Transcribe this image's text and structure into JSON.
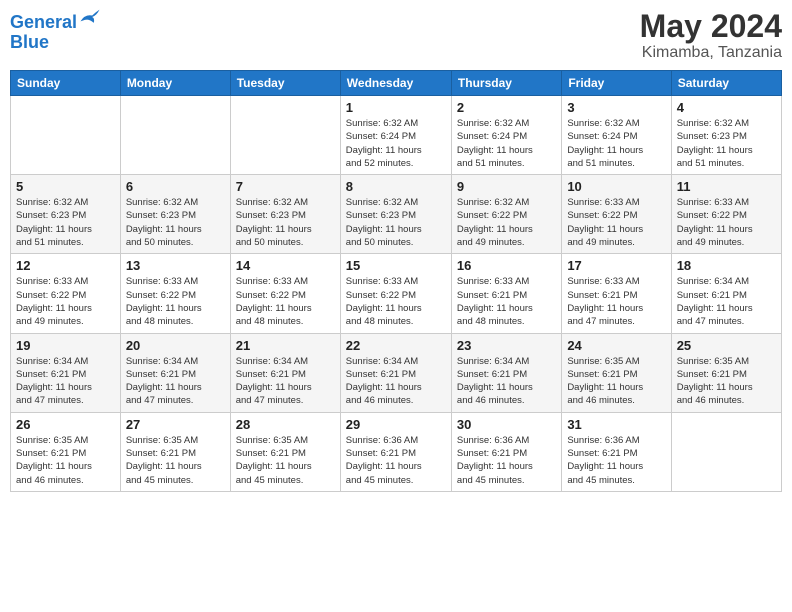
{
  "header": {
    "logo_line1": "General",
    "logo_line2": "Blue",
    "month": "May 2024",
    "location": "Kimamba, Tanzania"
  },
  "days_of_week": [
    "Sunday",
    "Monday",
    "Tuesday",
    "Wednesday",
    "Thursday",
    "Friday",
    "Saturday"
  ],
  "weeks": [
    [
      {
        "day": "",
        "info": ""
      },
      {
        "day": "",
        "info": ""
      },
      {
        "day": "",
        "info": ""
      },
      {
        "day": "1",
        "info": "Sunrise: 6:32 AM\nSunset: 6:24 PM\nDaylight: 11 hours\nand 52 minutes."
      },
      {
        "day": "2",
        "info": "Sunrise: 6:32 AM\nSunset: 6:24 PM\nDaylight: 11 hours\nand 51 minutes."
      },
      {
        "day": "3",
        "info": "Sunrise: 6:32 AM\nSunset: 6:24 PM\nDaylight: 11 hours\nand 51 minutes."
      },
      {
        "day": "4",
        "info": "Sunrise: 6:32 AM\nSunset: 6:23 PM\nDaylight: 11 hours\nand 51 minutes."
      }
    ],
    [
      {
        "day": "5",
        "info": "Sunrise: 6:32 AM\nSunset: 6:23 PM\nDaylight: 11 hours\nand 51 minutes."
      },
      {
        "day": "6",
        "info": "Sunrise: 6:32 AM\nSunset: 6:23 PM\nDaylight: 11 hours\nand 50 minutes."
      },
      {
        "day": "7",
        "info": "Sunrise: 6:32 AM\nSunset: 6:23 PM\nDaylight: 11 hours\nand 50 minutes."
      },
      {
        "day": "8",
        "info": "Sunrise: 6:32 AM\nSunset: 6:23 PM\nDaylight: 11 hours\nand 50 minutes."
      },
      {
        "day": "9",
        "info": "Sunrise: 6:32 AM\nSunset: 6:22 PM\nDaylight: 11 hours\nand 49 minutes."
      },
      {
        "day": "10",
        "info": "Sunrise: 6:33 AM\nSunset: 6:22 PM\nDaylight: 11 hours\nand 49 minutes."
      },
      {
        "day": "11",
        "info": "Sunrise: 6:33 AM\nSunset: 6:22 PM\nDaylight: 11 hours\nand 49 minutes."
      }
    ],
    [
      {
        "day": "12",
        "info": "Sunrise: 6:33 AM\nSunset: 6:22 PM\nDaylight: 11 hours\nand 49 minutes."
      },
      {
        "day": "13",
        "info": "Sunrise: 6:33 AM\nSunset: 6:22 PM\nDaylight: 11 hours\nand 48 minutes."
      },
      {
        "day": "14",
        "info": "Sunrise: 6:33 AM\nSunset: 6:22 PM\nDaylight: 11 hours\nand 48 minutes."
      },
      {
        "day": "15",
        "info": "Sunrise: 6:33 AM\nSunset: 6:22 PM\nDaylight: 11 hours\nand 48 minutes."
      },
      {
        "day": "16",
        "info": "Sunrise: 6:33 AM\nSunset: 6:21 PM\nDaylight: 11 hours\nand 48 minutes."
      },
      {
        "day": "17",
        "info": "Sunrise: 6:33 AM\nSunset: 6:21 PM\nDaylight: 11 hours\nand 47 minutes."
      },
      {
        "day": "18",
        "info": "Sunrise: 6:34 AM\nSunset: 6:21 PM\nDaylight: 11 hours\nand 47 minutes."
      }
    ],
    [
      {
        "day": "19",
        "info": "Sunrise: 6:34 AM\nSunset: 6:21 PM\nDaylight: 11 hours\nand 47 minutes."
      },
      {
        "day": "20",
        "info": "Sunrise: 6:34 AM\nSunset: 6:21 PM\nDaylight: 11 hours\nand 47 minutes."
      },
      {
        "day": "21",
        "info": "Sunrise: 6:34 AM\nSunset: 6:21 PM\nDaylight: 11 hours\nand 47 minutes."
      },
      {
        "day": "22",
        "info": "Sunrise: 6:34 AM\nSunset: 6:21 PM\nDaylight: 11 hours\nand 46 minutes."
      },
      {
        "day": "23",
        "info": "Sunrise: 6:34 AM\nSunset: 6:21 PM\nDaylight: 11 hours\nand 46 minutes."
      },
      {
        "day": "24",
        "info": "Sunrise: 6:35 AM\nSunset: 6:21 PM\nDaylight: 11 hours\nand 46 minutes."
      },
      {
        "day": "25",
        "info": "Sunrise: 6:35 AM\nSunset: 6:21 PM\nDaylight: 11 hours\nand 46 minutes."
      }
    ],
    [
      {
        "day": "26",
        "info": "Sunrise: 6:35 AM\nSunset: 6:21 PM\nDaylight: 11 hours\nand 46 minutes."
      },
      {
        "day": "27",
        "info": "Sunrise: 6:35 AM\nSunset: 6:21 PM\nDaylight: 11 hours\nand 45 minutes."
      },
      {
        "day": "28",
        "info": "Sunrise: 6:35 AM\nSunset: 6:21 PM\nDaylight: 11 hours\nand 45 minutes."
      },
      {
        "day": "29",
        "info": "Sunrise: 6:36 AM\nSunset: 6:21 PM\nDaylight: 11 hours\nand 45 minutes."
      },
      {
        "day": "30",
        "info": "Sunrise: 6:36 AM\nSunset: 6:21 PM\nDaylight: 11 hours\nand 45 minutes."
      },
      {
        "day": "31",
        "info": "Sunrise: 6:36 AM\nSunset: 6:21 PM\nDaylight: 11 hours\nand 45 minutes."
      },
      {
        "day": "",
        "info": ""
      }
    ]
  ]
}
